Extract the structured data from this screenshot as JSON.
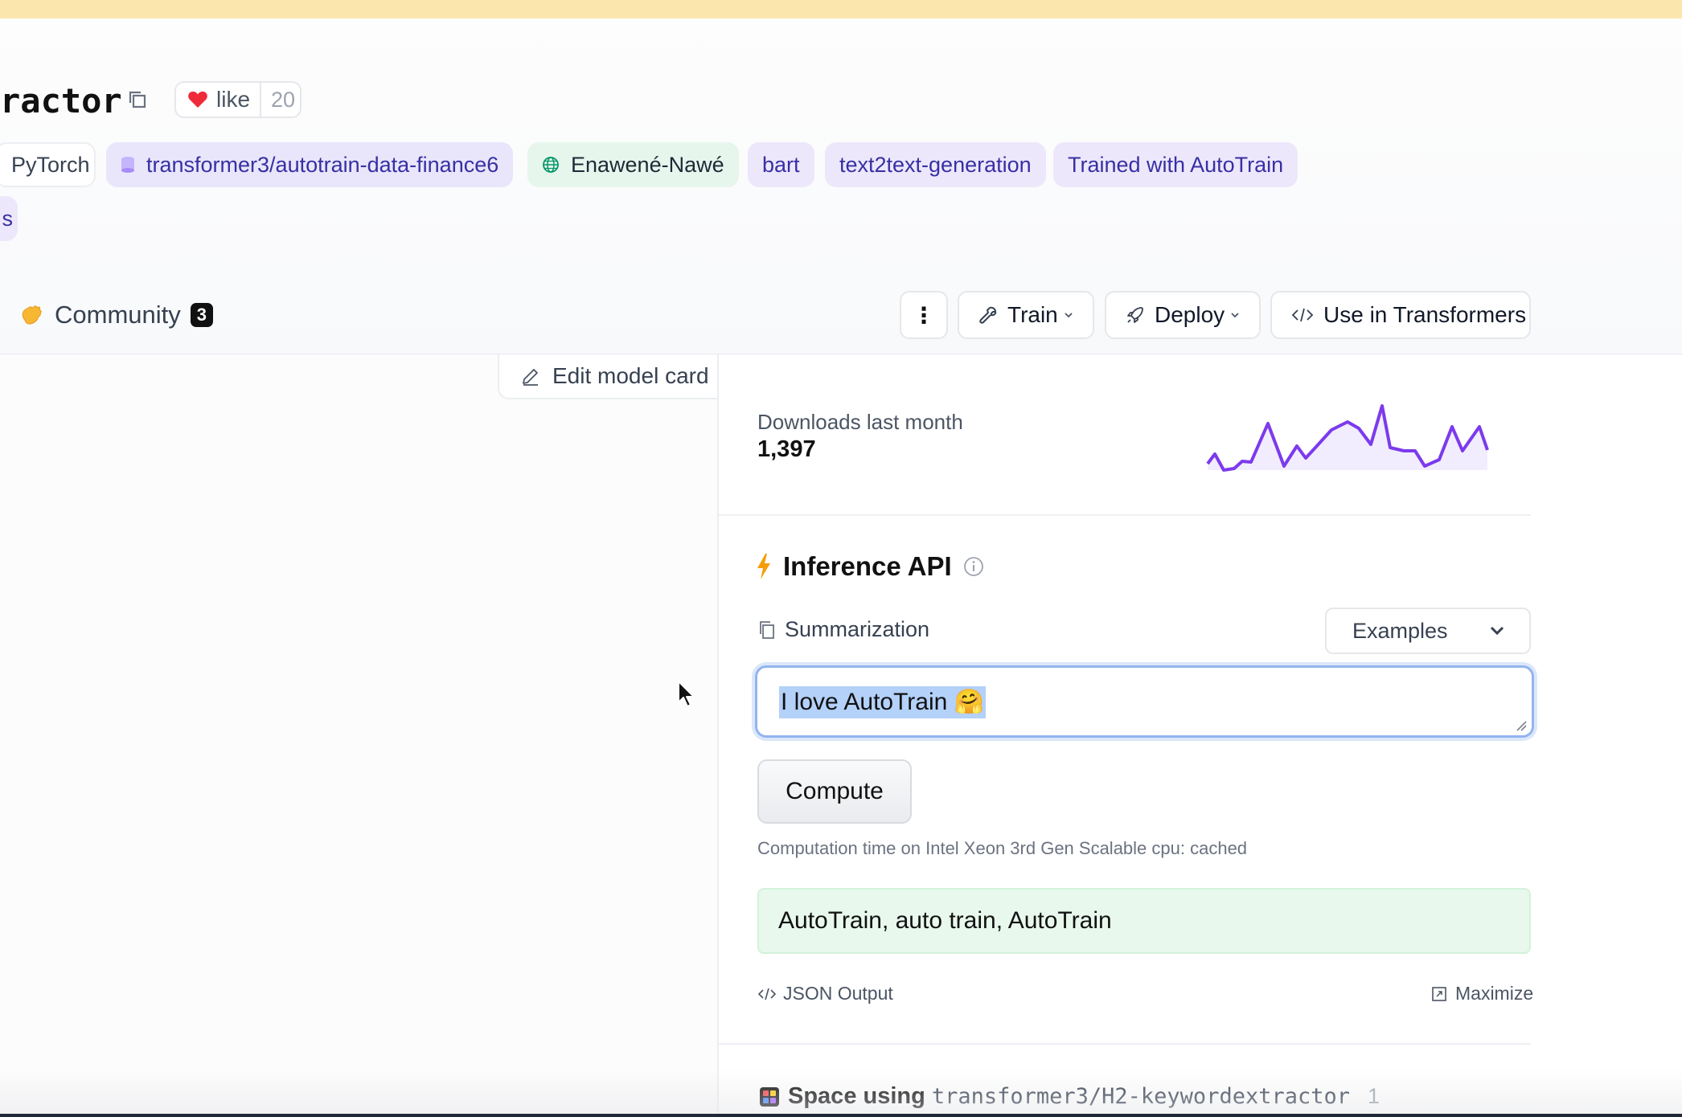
{
  "model": {
    "title_fragment": "ractor",
    "like_label": "like",
    "like_count": "20"
  },
  "tags": {
    "framework": "PyTorch",
    "dataset": "transformer3/autotrain-data-finance6",
    "language": "Enawené-Nawé",
    "arch": "bart",
    "task": "text2text-generation",
    "trained": "Trained with AutoTrain",
    "more": "s"
  },
  "tabs": {
    "community_label": "Community",
    "community_count": "3"
  },
  "actions": {
    "more": "⋮",
    "train": "Train",
    "deploy": "Deploy",
    "use": "Use in Transformers"
  },
  "edit_card": "Edit model card",
  "downloads": {
    "label": "Downloads last month",
    "value": "1,397"
  },
  "inference": {
    "title": "Inference API",
    "task": "Summarization",
    "examples_label": "Examples",
    "input_text": "I love AutoTrain 🤗",
    "compute_label": "Compute",
    "computation_time": "Computation time on Intel Xeon 3rd Gen Scalable cpu: cached",
    "output_text": "AutoTrain, auto train, AutoTrain",
    "json_output": "JSON Output",
    "maximize": "Maximize"
  },
  "spaces": {
    "label": "Space using",
    "repo": "transformer3/H2-keywordextractor",
    "count": "1"
  },
  "colors": {
    "accent_purple": "#7c3aed",
    "bolt_orange": "#f59e0b",
    "selection_blue": "#b3d1f9",
    "output_green": "#e8f8ed"
  }
}
